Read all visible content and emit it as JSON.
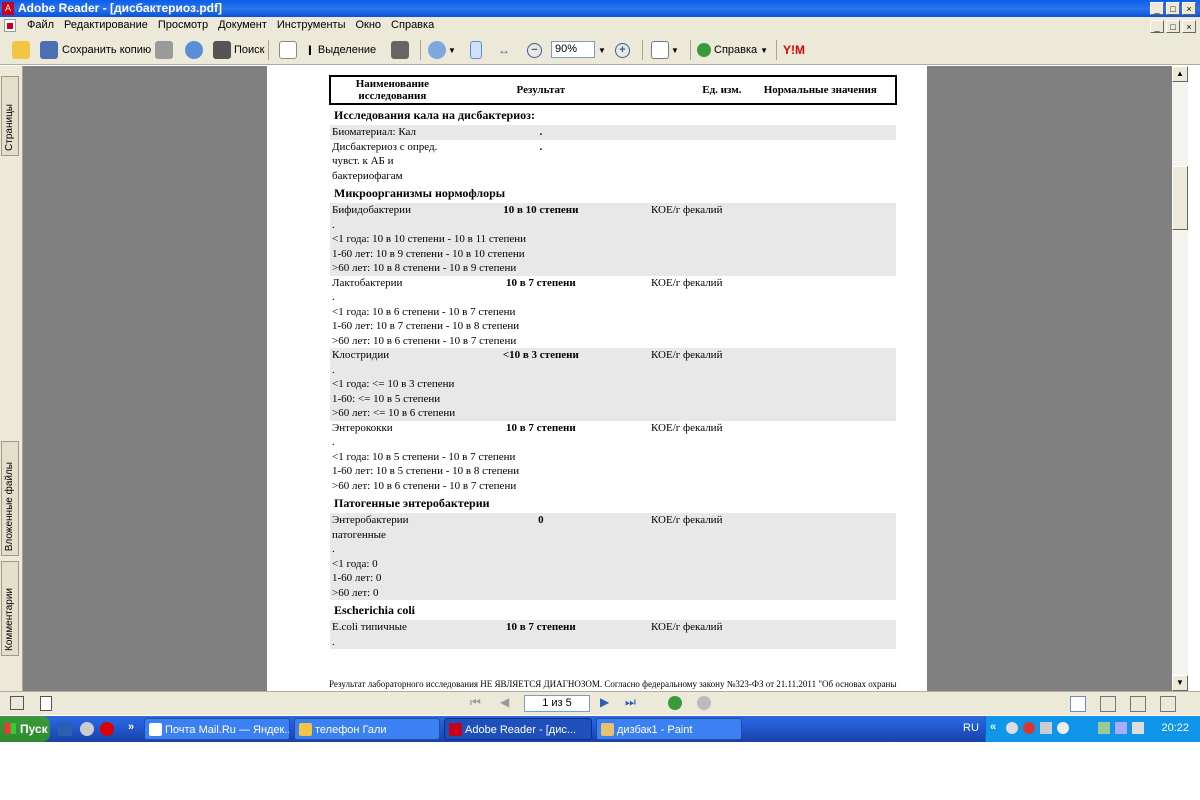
{
  "window": {
    "title": "Adobe Reader - [дисбактериоз.pdf]"
  },
  "menu": [
    "Файл",
    "Редактирование",
    "Просмотр",
    "Документ",
    "Инструменты",
    "Окно",
    "Справка"
  ],
  "toolbar": {
    "save_copy": "Сохранить копию",
    "search": "Поиск",
    "select": "Выделение",
    "zoom": "90%",
    "help": "Справка"
  },
  "sidebar": {
    "pages": "Страницы",
    "attachments": "Вложенные файлы",
    "comments": "Комментарии"
  },
  "report": {
    "headers": [
      "Наименование исследования",
      "Результат",
      "Ед. изм.",
      "Нормальные значения"
    ],
    "sections": [
      {
        "title": "Исследования кала на дисбактериоз:",
        "rows": [
          {
            "name": "Биоматериал: Кал",
            "result": ".",
            "unit": "",
            "norms": [],
            "grey": true
          },
          {
            "name": "Дисбактериоз с опред. чувст. к АБ и бактериофагам",
            "result": ".",
            "unit": "",
            "norms": [],
            "grey": false
          }
        ]
      },
      {
        "title": "Микроорганизмы нормофлоры",
        "rows": [
          {
            "name": "Бифидобактерии",
            "result": "10 в 10 степени",
            "unit": "КОЕ/г фекалий",
            "norms": [
              ".",
              "<1 года: 10 в 10 степени - 10 в 11 степени",
              "1-60 лет: 10 в 9 степени - 10 в 10 степени",
              ">60 лет: 10 в 8 степени - 10 в 9 степени"
            ],
            "grey": true
          },
          {
            "name": "Лактобактерии",
            "result": "10 в 7 степени",
            "unit": "КОЕ/г фекалий",
            "norms": [
              ".",
              "<1 года: 10 в 6 степени - 10 в 7 степени",
              "1-60 лет: 10 в 7 степени - 10 в 8 степени",
              ">60 лет: 10 в 6 степени - 10 в 7 степени"
            ],
            "grey": false
          },
          {
            "name": "Клостридии",
            "result": "<10 в 3 степени",
            "unit": "КОЕ/г фекалий",
            "norms": [
              ".",
              "<1 года: <= 10 в 3 степени",
              "1-60: <= 10 в 5 степени",
              ">60 лет: <= 10 в 6 степени"
            ],
            "grey": true
          },
          {
            "name": "Энтерококки",
            "result": "10 в 7 степени",
            "unit": "КОЕ/г фекалий",
            "norms": [
              ".",
              "<1 года: 10 в 5 степени  - 10 в 7 степени",
              "1-60 лет: 10 в 5 степени  - 10 в 8 степени",
              ">60 лет: 10 в 6 степени  - 10 в 7 степени"
            ],
            "grey": false
          }
        ]
      },
      {
        "title": "Патогенные энтеробактерии",
        "rows": [
          {
            "name": "Энтеробактерии патогенные",
            "result": "0",
            "unit": "КОЕ/г фекалий",
            "norms": [
              ".",
              "<1 года: 0",
              "1-60 лет: 0",
              ">60 лет: 0"
            ],
            "grey": true
          }
        ]
      },
      {
        "title": "Escherichia coli",
        "rows": [
          {
            "name": "E.coli типичные",
            "result": "10 в 7 степени",
            "unit": "КОЕ/г фекалий",
            "norms": [
              "."
            ],
            "grey": true
          }
        ]
      }
    ],
    "footer": "Результат лабораторного исследования НЕ ЯВЛЯЕТСЯ ДИАГНОЗОМ. Согласно федеральному закону №323-ФЗ от 21.11.2011 \"Об основах охраны"
  },
  "status": {
    "page_field": "1 из 5"
  },
  "taskbar": {
    "start": "Пуск",
    "tasks": [
      "Почта Mail.Ru — Яндек...",
      "телефон Гали",
      "Adobe Reader - [дис...",
      "дизбак1 - Paint"
    ],
    "lang": "RU",
    "time": "20:22"
  },
  "colors": {
    "titlebar": "#0a5ee8",
    "chrome": "#ece9d8",
    "workspace": "#808080",
    "row_grey": "#e8e8e8"
  }
}
